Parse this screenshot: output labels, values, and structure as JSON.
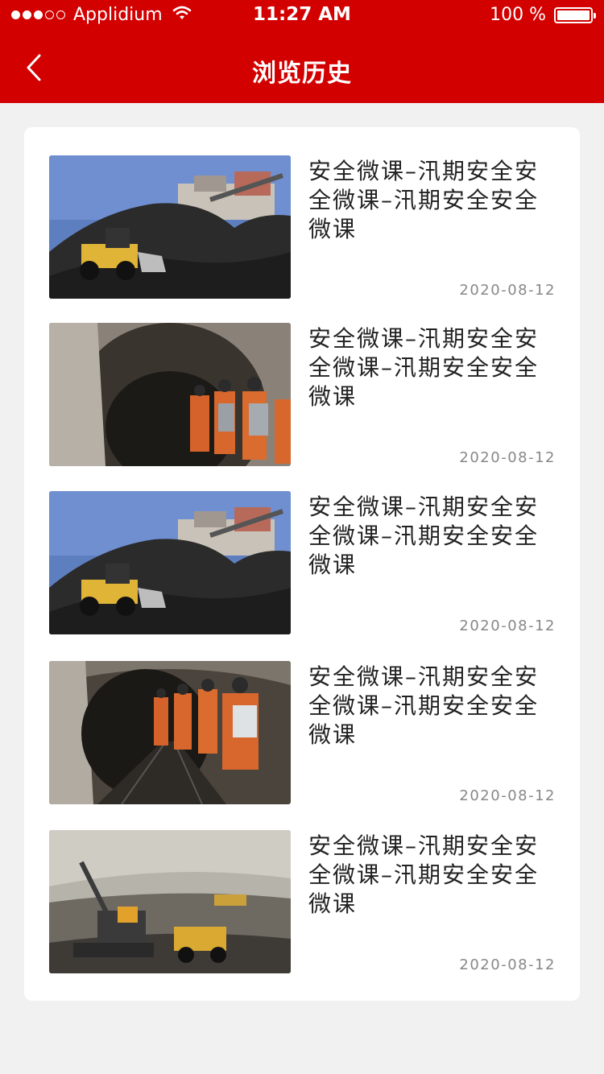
{
  "status_bar": {
    "carrier": "Applidium",
    "time": "11:27 AM",
    "battery": "100 %"
  },
  "nav": {
    "title": "浏览历史",
    "back_icon": "chevron-left-icon"
  },
  "history": [
    {
      "title": "安全微课–汛期安全安全微课–汛期安全安全微课",
      "date": "2020-08-12",
      "image": "coal-loader"
    },
    {
      "title": "安全微课–汛期安全安全微课–汛期安全安全微课",
      "date": "2020-08-12",
      "image": "miners-tunnel"
    },
    {
      "title": "安全微课–汛期安全安全微课–汛期安全安全微课",
      "date": "2020-08-12",
      "image": "coal-loader"
    },
    {
      "title": "安全微课–汛期安全安全微课–汛期安全安全微课",
      "date": "2020-08-12",
      "image": "miners-track"
    },
    {
      "title": "安全微课–汛期安全安全微课–汛期安全安全微课",
      "date": "2020-08-12",
      "image": "open-pit-excavator"
    }
  ],
  "colors": {
    "header": "#d30000",
    "background": "#f1f1f1",
    "card": "#ffffff"
  }
}
